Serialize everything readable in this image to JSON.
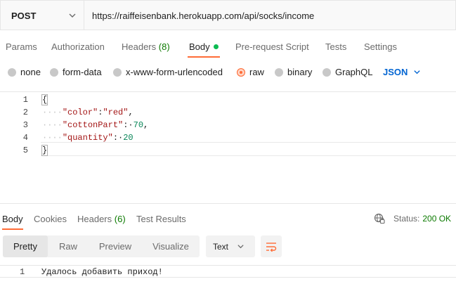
{
  "request": {
    "method": "POST",
    "url": "https://raiffeisenbank.herokuapp.com/api/socks/income"
  },
  "request_tabs": [
    {
      "label": "Params"
    },
    {
      "label": "Authorization"
    },
    {
      "label": "Headers",
      "count": "(8)"
    },
    {
      "label": "Body",
      "active": true
    },
    {
      "label": "Pre-request Script"
    },
    {
      "label": "Tests"
    },
    {
      "label": "Settings"
    }
  ],
  "body_types": [
    {
      "label": "none",
      "selected": false
    },
    {
      "label": "form-data",
      "selected": false
    },
    {
      "label": "x-www-form-urlencoded",
      "selected": false
    },
    {
      "label": "raw",
      "selected": true
    },
    {
      "label": "binary",
      "selected": false
    },
    {
      "label": "GraphQL",
      "selected": false
    }
  ],
  "format": "JSON",
  "editor": {
    "line_numbers": [
      "1",
      "2",
      "3",
      "4",
      "5"
    ],
    "open_brace": "{",
    "close_brace": "}",
    "indent": "····",
    "fields": [
      {
        "key": "\"color\"",
        "sep": ":",
        "value": "\"red\"",
        "trail": ","
      },
      {
        "key": "\"cottonPart\"",
        "sep": ":·",
        "value": "70",
        "trail": ","
      },
      {
        "key": "\"quantity\"",
        "sep": ":·",
        "value": "20",
        "trail": ""
      }
    ]
  },
  "response_tabs": [
    {
      "label": "Body",
      "active": true
    },
    {
      "label": "Cookies"
    },
    {
      "label": "Headers",
      "count": "(6)"
    },
    {
      "label": "Test Results"
    }
  ],
  "status": {
    "label": "Status:",
    "value": "200 OK"
  },
  "view_modes": [
    {
      "label": "Pretty",
      "active": true
    },
    {
      "label": "Raw"
    },
    {
      "label": "Preview"
    },
    {
      "label": "Visualize"
    }
  ],
  "response_format": "Text",
  "response": {
    "line_number": "1",
    "text": "Удалось добавить приход!"
  },
  "colors": {
    "accent": "#ff6c37",
    "active_dot": "#0cbb52",
    "link_blue": "#0265d2",
    "count_green": "#0c7a00"
  },
  "icons": [
    "chevron-down-icon",
    "globe-icon",
    "wrap-lines-icon"
  ]
}
